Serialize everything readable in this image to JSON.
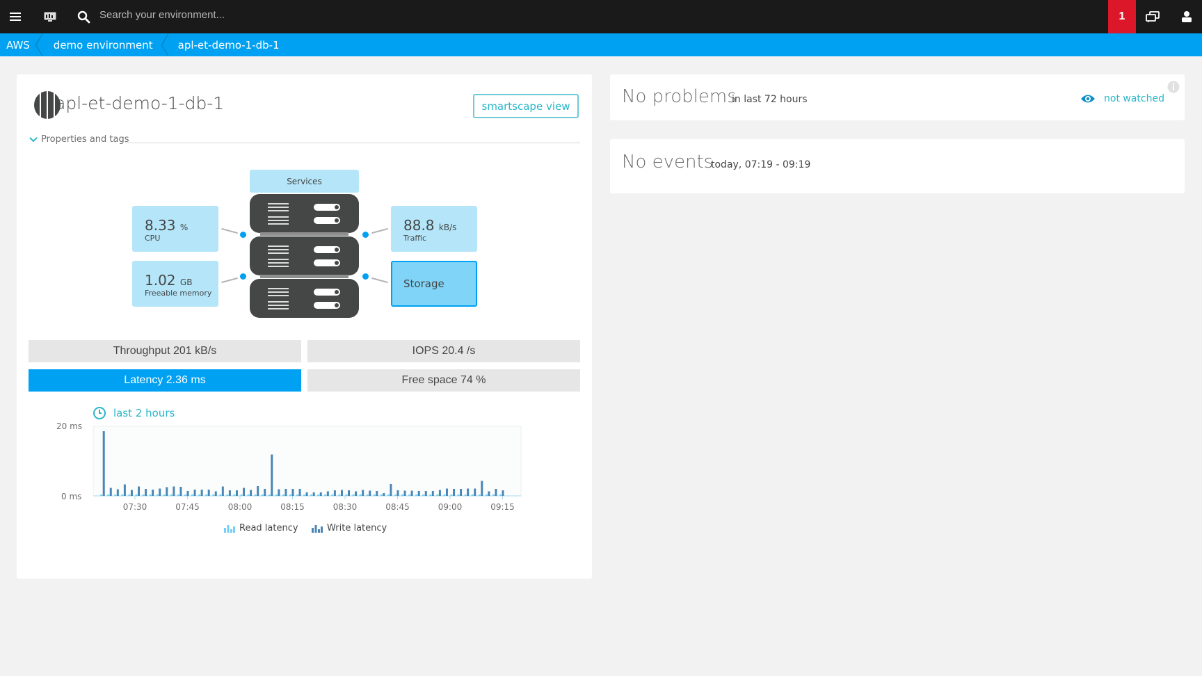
{
  "topbar": {
    "search_placeholder": "Search your environment...",
    "problem_count": "1",
    "icons": [
      "menu-icon",
      "dashboard-icon",
      "search-icon",
      "chat-windows-icon",
      "user-icon"
    ]
  },
  "breadcrumb": [
    "AWS",
    "demo environment",
    "apl-et-demo-1-db-1"
  ],
  "entity": {
    "title": "apl-et-demo-1-db-1",
    "smartscape_label": "smartscape view",
    "properties_label": "Properties and tags"
  },
  "infographic": {
    "services_label": "Services",
    "cpu": {
      "value": "8.33",
      "unit": "%",
      "label": "CPU"
    },
    "memory": {
      "value": "1.02",
      "unit": "GB",
      "label": "Freeable memory"
    },
    "traffic": {
      "value": "88.8",
      "unit": "kB/s",
      "label": "Traffic"
    },
    "storage_label": "Storage"
  },
  "metrics": {
    "throughput": "Throughput 201 kB/s",
    "iops": "IOPS 20.4 /s",
    "latency": "Latency 2.36 ms",
    "free_space": "Free space 74 %"
  },
  "timeframe_label": "last 2 hours",
  "chart_data": {
    "type": "bar",
    "title": "Latency",
    "ylabel": "",
    "xlabel": "",
    "ylim": [
      0,
      20
    ],
    "y_ticks": [
      "20 ms",
      "0 ms"
    ],
    "x_ticks": [
      "07:30",
      "07:45",
      "08:00",
      "08:15",
      "08:30",
      "08:45",
      "09:00",
      "09:15"
    ],
    "x_start": "07:20",
    "x_step_minutes": 2,
    "legend": [
      "Read latency",
      "Write latency"
    ],
    "series": [
      {
        "name": "Read latency",
        "color": "#74cff7",
        "values": [
          0.4,
          0.4,
          0.4,
          0.4,
          0.4,
          0.4,
          0.4,
          0.4,
          0.4,
          0.4,
          0.4,
          0.4,
          0.4,
          0.4,
          0.4,
          0.4,
          0.4,
          0.4,
          0.4,
          0.4,
          0.4,
          0.4,
          0.4,
          0.4,
          0.4,
          0.4,
          0.4,
          0.4,
          0.4,
          0.4,
          0.4,
          0.4,
          0.4,
          0.4,
          0.4,
          0.4,
          0.4,
          0.4,
          0.4,
          0.4,
          0.4,
          0.4,
          0.4,
          0.4,
          0.4,
          0.4,
          0.4,
          0.4,
          0.4,
          0.4,
          0.4,
          0.4,
          0.4,
          0.4,
          0.4,
          0.4,
          0.4,
          0.4
        ]
      },
      {
        "name": "Write latency",
        "color": "#4a86b5",
        "values": [
          18.6,
          2.3,
          1.9,
          3.3,
          1.7,
          2.7,
          2.0,
          1.8,
          2.1,
          2.5,
          2.7,
          2.6,
          1.4,
          1.8,
          1.8,
          1.8,
          1.3,
          2.7,
          1.6,
          1.6,
          2.3,
          1.7,
          2.8,
          2.0,
          11.9,
          1.9,
          2.0,
          2.0,
          2.0,
          1.0,
          1.0,
          1.0,
          1.3,
          1.6,
          1.7,
          1.6,
          1.3,
          1.7,
          1.5,
          1.4,
          0.8,
          3.4,
          1.6,
          1.5,
          1.5,
          1.4,
          1.4,
          1.4,
          1.7,
          2.1,
          2.0,
          2.0,
          2.1,
          2.1,
          4.3,
          1.3,
          2.0,
          1.6
        ]
      }
    ]
  },
  "problems": {
    "title": "No problems",
    "subtitle": "in last 72 hours",
    "watch_label": "not watched"
  },
  "events": {
    "title": "No events",
    "subtitle": "today, 07:19 - 09:19"
  }
}
